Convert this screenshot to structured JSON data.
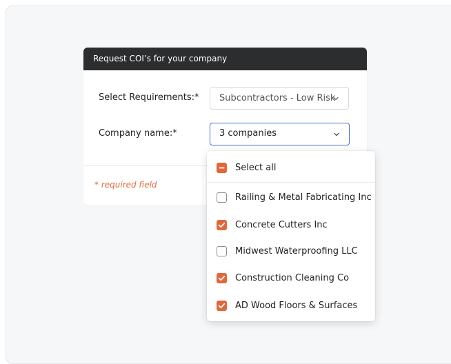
{
  "card": {
    "title": "Request COI’s for your company",
    "requirements_label": "Select Requirements:*",
    "requirements_value": "Subcontractors - Low Risk",
    "company_label": "Company name:*",
    "company_value": "3 companies",
    "required_note": "* required field"
  },
  "dropdown": {
    "select_all_label": "Select all",
    "select_all_state": "indeterminate",
    "options": [
      {
        "label": "Railing & Metal Fabricating Inc",
        "checked": false
      },
      {
        "label": "Concrete Cutters Inc",
        "checked": true
      },
      {
        "label": "Midwest Waterproofing LLC",
        "checked": false
      },
      {
        "label": "Construction Cleaning Co",
        "checked": true
      },
      {
        "label": "AD Wood Floors & Surfaces",
        "checked": true
      }
    ]
  },
  "colors": {
    "header_bg": "#2b2d2e",
    "accent_orange": "#e2673b",
    "focus_blue": "#3f6fd1",
    "required_text": "#e06a3c"
  },
  "icons": {
    "select_chevron": "chevron-down-icon",
    "checkbox_checked": "checkmark-icon",
    "checkbox_mixed": "minus-icon"
  }
}
